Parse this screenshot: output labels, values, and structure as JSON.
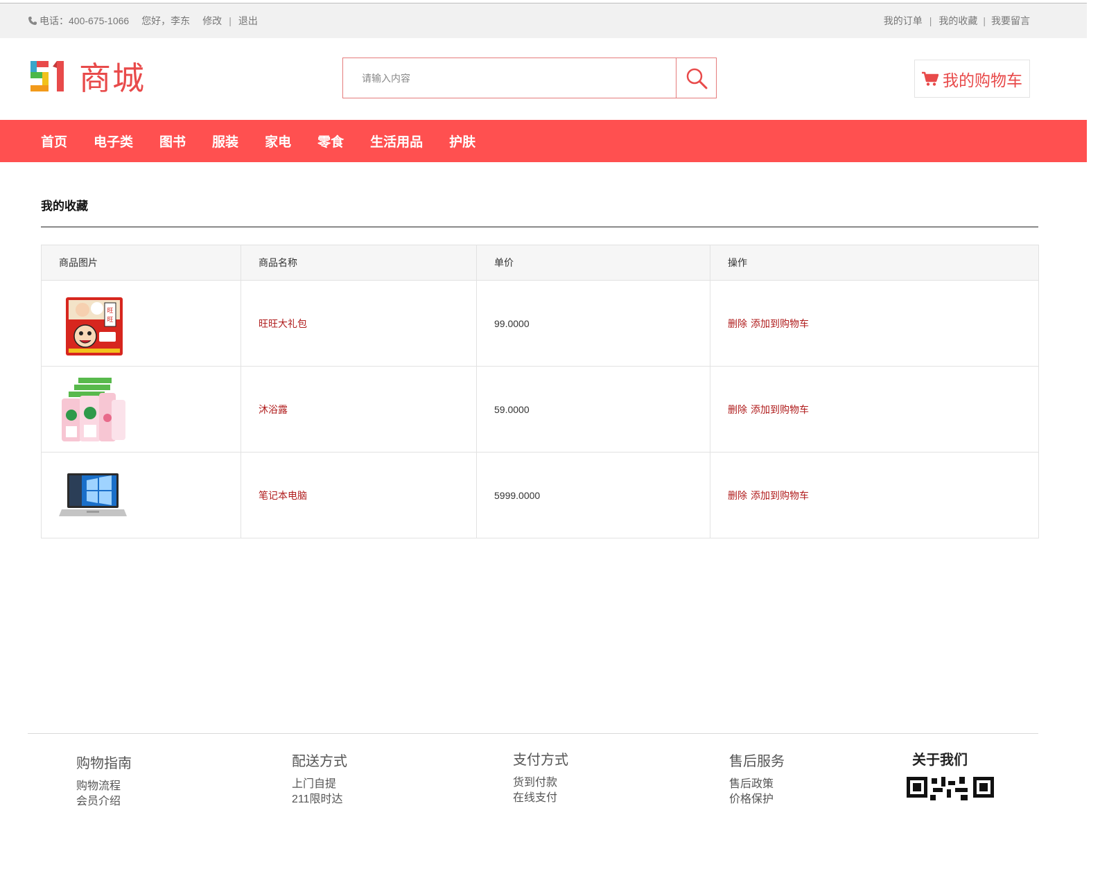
{
  "topbar": {
    "phone": "电话：400-675-1066",
    "greeting": "您好，李东",
    "edit": "修改",
    "separator": "|",
    "logout": "退出",
    "links": [
      "我的订单",
      "我的收藏",
      "我要留言"
    ]
  },
  "header": {
    "logo_number": "51",
    "logo_text": "商城",
    "search_placeholder": "请输入内容",
    "cart_label": "我的购物车"
  },
  "nav": [
    "首页",
    "电子类",
    "图书",
    "服装",
    "家电",
    "零食",
    "生活用品",
    "护肤"
  ],
  "favorites": {
    "title": "我的收藏",
    "columns": [
      "商品图片",
      "商品名称",
      "单价",
      "操作"
    ],
    "rows": [
      {
        "image": "wangwang-gift-bag",
        "name": "旺旺大礼包",
        "price": "99.0000",
        "delete": "删除",
        "add_to_cart": "添加到购物车"
      },
      {
        "image": "body-wash",
        "name": "沐浴露",
        "price": "59.0000",
        "delete": "删除",
        "add_to_cart": "添加到购物车"
      },
      {
        "image": "laptop",
        "name": "笔记本电脑",
        "price": "5999.0000",
        "delete": "删除",
        "add_to_cart": "添加到购物车"
      }
    ]
  },
  "footer": {
    "columns": [
      {
        "title": "购物指南",
        "items": [
          "购物流程",
          "会员介绍"
        ]
      },
      {
        "title": "配送方式",
        "items": [
          "上门自提",
          "211限时达"
        ]
      },
      {
        "title": "支付方式",
        "items": [
          "货到付款",
          "在线支付"
        ]
      },
      {
        "title": "售后服务",
        "items": [
          "售后政策",
          "价格保护"
        ]
      },
      {
        "title": "关于我们",
        "items": []
      }
    ]
  },
  "colors": {
    "accent": "#ff5050",
    "link": "#b01c1c",
    "logo": "#e84a4a"
  }
}
